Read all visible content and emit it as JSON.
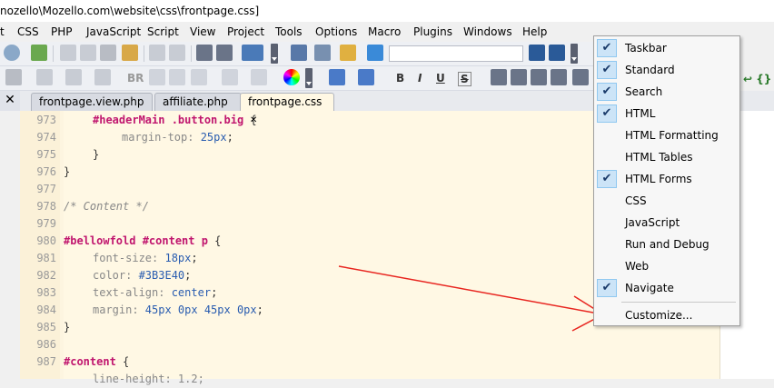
{
  "window": {
    "title": "nozello\\Mozello.com\\website\\css\\frontpage.css]"
  },
  "menubar": [
    {
      "label": "t"
    },
    {
      "label": "CSS"
    },
    {
      "label": "PHP"
    },
    {
      "label": "JavaScript"
    },
    {
      "label": "Script"
    },
    {
      "label": "View"
    },
    {
      "label": "Project"
    },
    {
      "label": "Tools"
    },
    {
      "label": "Options"
    },
    {
      "label": "Macro"
    },
    {
      "label": "Plugins"
    },
    {
      "label": "Windows"
    },
    {
      "label": "Help"
    }
  ],
  "toolbar2": {
    "bold": "B",
    "italic": "I",
    "underline": "U",
    "strike": "S",
    "br": "BR"
  },
  "tabs": [
    {
      "label": "frontpage.view.php"
    },
    {
      "label": "affiliate.php"
    },
    {
      "label": "frontpage.css",
      "close": "✕"
    }
  ],
  "editor": {
    "lines": [
      {
        "n": "973"
      },
      {
        "n": "974"
      },
      {
        "n": "975"
      },
      {
        "n": "976"
      },
      {
        "n": "977"
      },
      {
        "n": "978"
      },
      {
        "n": "979"
      },
      {
        "n": "980"
      },
      {
        "n": "981"
      },
      {
        "n": "982"
      },
      {
        "n": "983"
      },
      {
        "n": "984"
      },
      {
        "n": "985"
      },
      {
        "n": "986"
      },
      {
        "n": "987"
      }
    ],
    "code": {
      "l973_sel": "#headerMain .button.big",
      "l973_brace": " {",
      "l974_prop": "margin-top:",
      "l974_val": " 25px",
      "l974_end": ";",
      "l975": "}",
      "l976": "}",
      "l978": "/* Content */",
      "l980_sel": "#bellowfold #content p",
      "l980_brace": " {",
      "l981_prop": "font-size:",
      "l981_val": " 18px",
      "l981_end": ";",
      "l982_prop": "color:",
      "l982_val": " #3B3E40",
      "l982_end": ";",
      "l983_prop": "text-align:",
      "l983_val": " center",
      "l983_end": ";",
      "l984_prop": "margin:",
      "l984_val": " 45px 0px 45px 0px",
      "l984_end": ";",
      "l985": "}",
      "l987_sel": "#content",
      "l987_brace": " {",
      "l988": "line-height: 1.2;"
    }
  },
  "toolbars_menu": {
    "items": [
      {
        "label": "Taskbar",
        "checked": true
      },
      {
        "label": "Standard",
        "checked": true
      },
      {
        "label": "Search",
        "checked": true
      },
      {
        "label": "HTML",
        "checked": true
      },
      {
        "label": "HTML Formatting",
        "checked": false
      },
      {
        "label": "HTML Tables",
        "checked": false
      },
      {
        "label": "HTML Forms",
        "checked": true
      },
      {
        "label": "CSS",
        "checked": false
      },
      {
        "label": "JavaScript",
        "checked": false
      },
      {
        "label": "Run and Debug",
        "checked": false
      },
      {
        "label": "Web",
        "checked": false
      },
      {
        "label": "Navigate",
        "checked": true
      }
    ],
    "customize": "Customize...",
    "check_glyph": "✔"
  },
  "colors": {
    "annotation_arrow": "#e8251f",
    "editor_bg": "#fff8e4",
    "selector": "#c0156e"
  }
}
